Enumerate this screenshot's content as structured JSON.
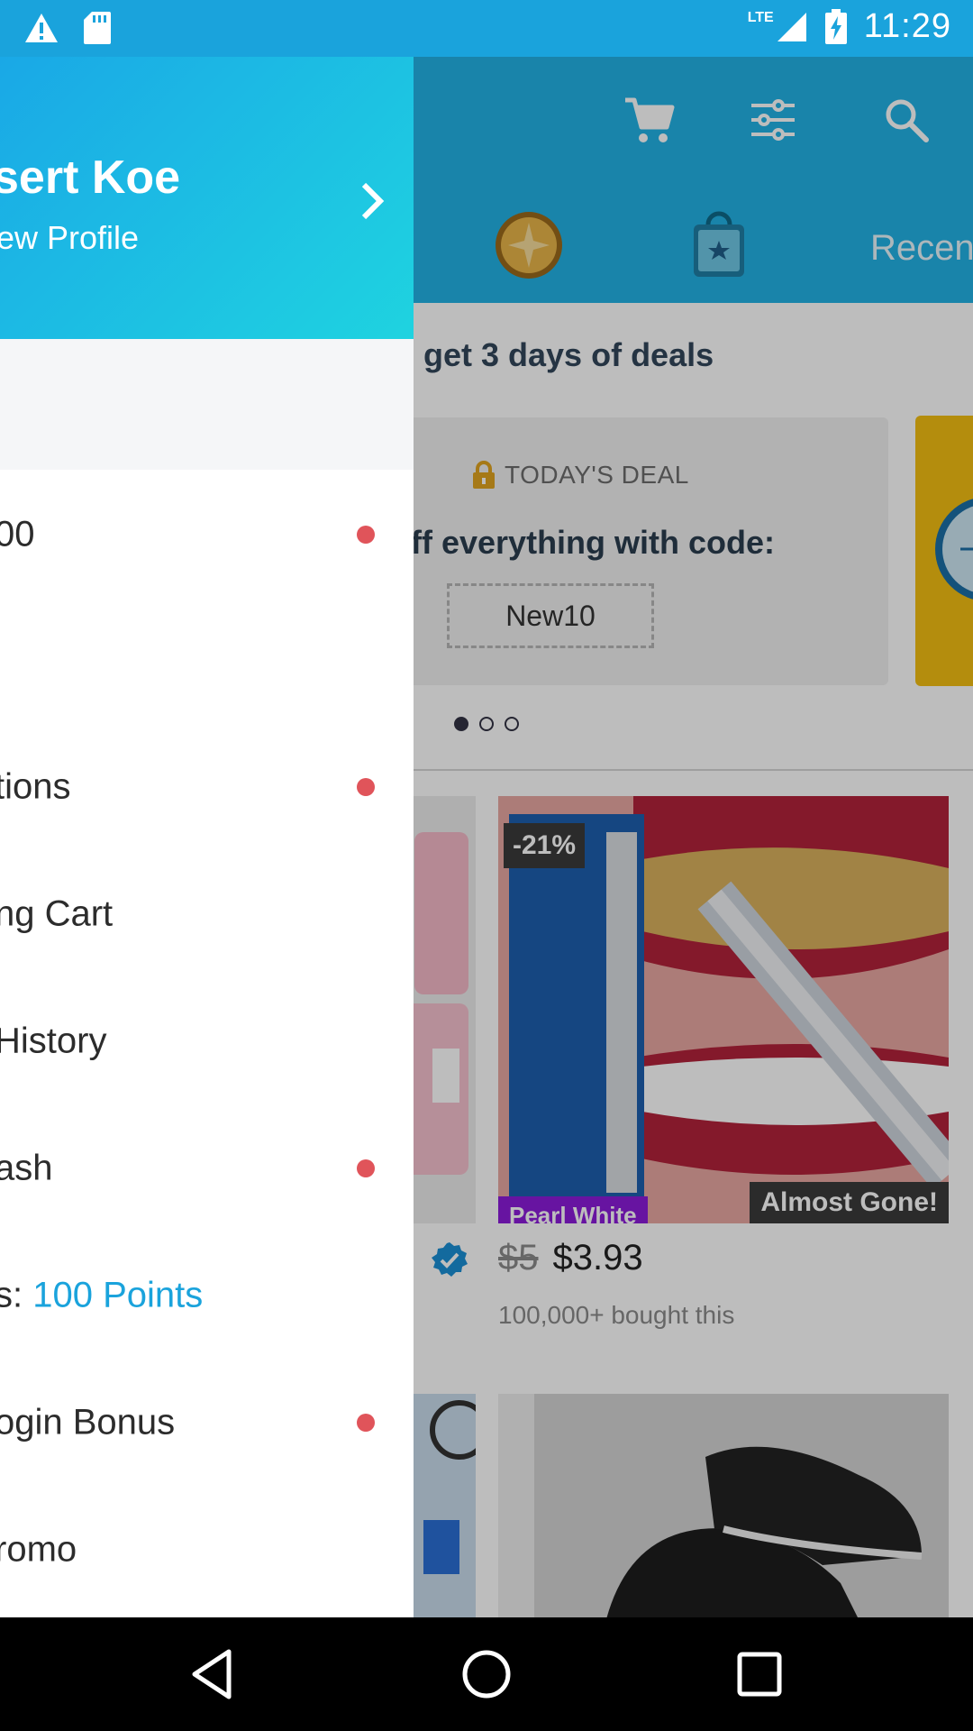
{
  "status_bar": {
    "network": "LTE",
    "time": "11:29",
    "icons": [
      "warning-icon",
      "sd-card-icon",
      "signal-icon",
      "battery-charging-icon"
    ]
  },
  "app": {
    "toolbar_icons": [
      "cart-icon",
      "filter-icon",
      "search-icon"
    ],
    "tabs": [
      {
        "icon": "coin-icon"
      },
      {
        "icon": "shopping-bag-star-icon"
      },
      {
        "label": "Recen"
      }
    ],
    "promo_banner": "get 3 days of deals",
    "deal_card": {
      "kicker": "TODAY'S DEAL",
      "text": "ff everything with code:",
      "code": "New10"
    },
    "carousel": {
      "count": 3,
      "active": 0
    },
    "product": {
      "discount_badge": "-21%",
      "status_badge": "Almost Gone!",
      "brand_tag": "Pearl White",
      "price_old": "$5",
      "price_new": "$3.93",
      "bought": "100,000+ bought this"
    }
  },
  "drawer": {
    "header": {
      "name": "sert Koe",
      "subtitle": "ew Profile"
    },
    "items": [
      {
        "label": "00",
        "dot": true
      },
      {
        "label": "tions",
        "dot": true
      },
      {
        "label": "ng Cart",
        "dot": false
      },
      {
        "label": "History",
        "dot": false
      },
      {
        "label": "ash",
        "dot": true
      },
      {
        "label": "s: ",
        "accent": "100 Points",
        "dot": false
      },
      {
        "label": "ogin Bonus",
        "dot": true
      },
      {
        "label": "romo",
        "dot": false
      }
    ]
  },
  "nav_bar": {
    "buttons": [
      "back-icon",
      "home-icon",
      "recents-icon"
    ]
  },
  "colors": {
    "status_bar": "#1aa3dc",
    "app_bar": "#22b3e6",
    "accent": "#1aa3dc",
    "notification_dot": "#e0545a",
    "deal_card_alt": "#f3bf12"
  }
}
